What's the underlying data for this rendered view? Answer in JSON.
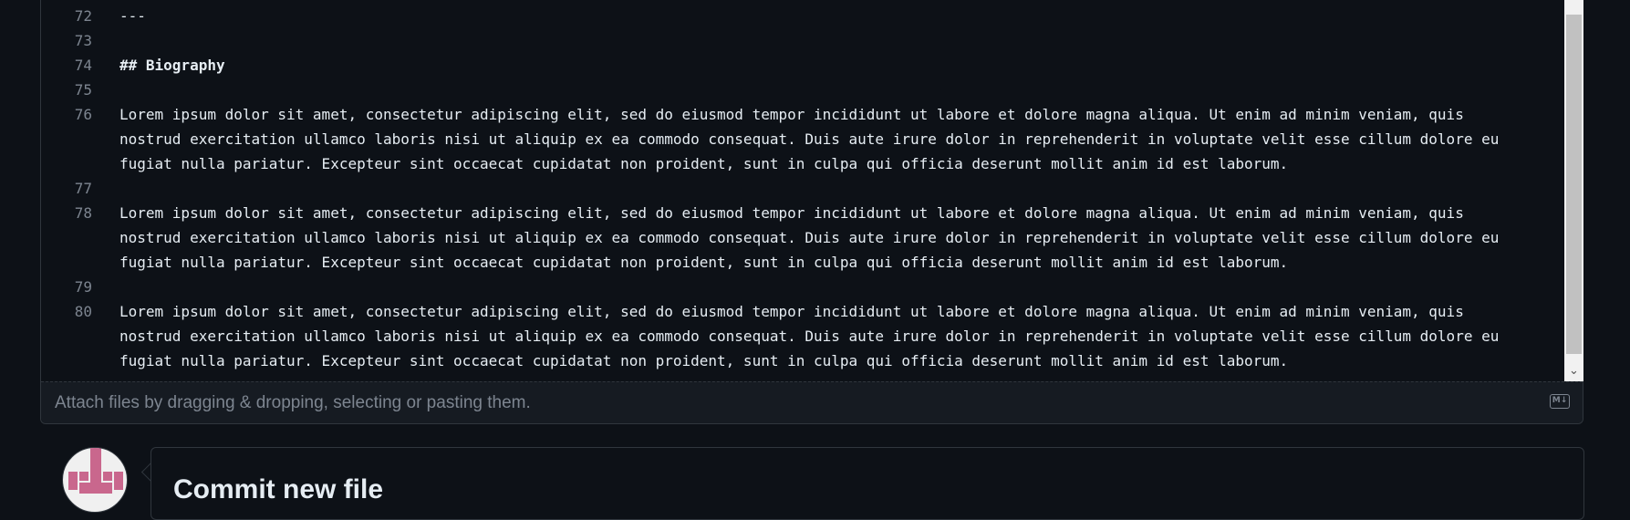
{
  "editor": {
    "lines": [
      {
        "number": "72",
        "text": "---"
      },
      {
        "number": "73",
        "text": ""
      },
      {
        "number": "74",
        "text": "## Biography"
      },
      {
        "number": "75",
        "text": ""
      },
      {
        "number": "76",
        "text": "Lorem ipsum dolor sit amet, consectetur adipiscing elit, sed do eiusmod tempor incididunt ut labore et dolore magna aliqua. Ut enim ad minim veniam, quis",
        "text2": "nostrud exercitation ullamco laboris nisi ut aliquip ex ea commodo consequat. Duis aute irure dolor in reprehenderit in voluptate velit esse cillum dolore eu",
        "text3": "fugiat nulla pariatur. Excepteur sint occaecat cupidatat non proident, sunt in culpa qui officia deserunt mollit anim id est laborum."
      },
      {
        "number": "77",
        "text": ""
      },
      {
        "number": "78",
        "text": "Lorem ipsum dolor sit amet, consectetur adipiscing elit, sed do eiusmod tempor incididunt ut labore et dolore magna aliqua. Ut enim ad minim veniam, quis",
        "text2": "nostrud exercitation ullamco laboris nisi ut aliquip ex ea commodo consequat. Duis aute irure dolor in reprehenderit in voluptate velit esse cillum dolore eu",
        "text3": "fugiat nulla pariatur. Excepteur sint occaecat cupidatat non proident, sunt in culpa qui officia deserunt mollit anim id est laborum."
      },
      {
        "number": "79",
        "text": ""
      },
      {
        "number": "80",
        "text": "Lorem ipsum dolor sit amet, consectetur adipiscing elit, sed do eiusmod tempor incididunt ut labore et dolore magna aliqua. Ut enim ad minim veniam, quis",
        "text2": "nostrud exercitation ullamco laboris nisi ut aliquip ex ea commodo consequat. Duis aute irure dolor in reprehenderit in voluptate velit esse cillum dolore eu",
        "text3": "fugiat nulla pariatur. Excepteur sint occaecat cupidatat non proident, sunt in culpa qui officia deserunt mollit anim id est laborum."
      }
    ]
  },
  "attach": {
    "text": "Attach files by dragging & dropping, selecting or pasting them.",
    "markdown_icon": "markdown-icon",
    "markdown_glyph": "M↓"
  },
  "commit": {
    "title": "Commit new file"
  },
  "colors": {
    "background": "#0d1117",
    "border": "#30363d",
    "line_number": "#7d8590",
    "text": "#e6edf3",
    "avatar_pink": "#c9678d"
  }
}
